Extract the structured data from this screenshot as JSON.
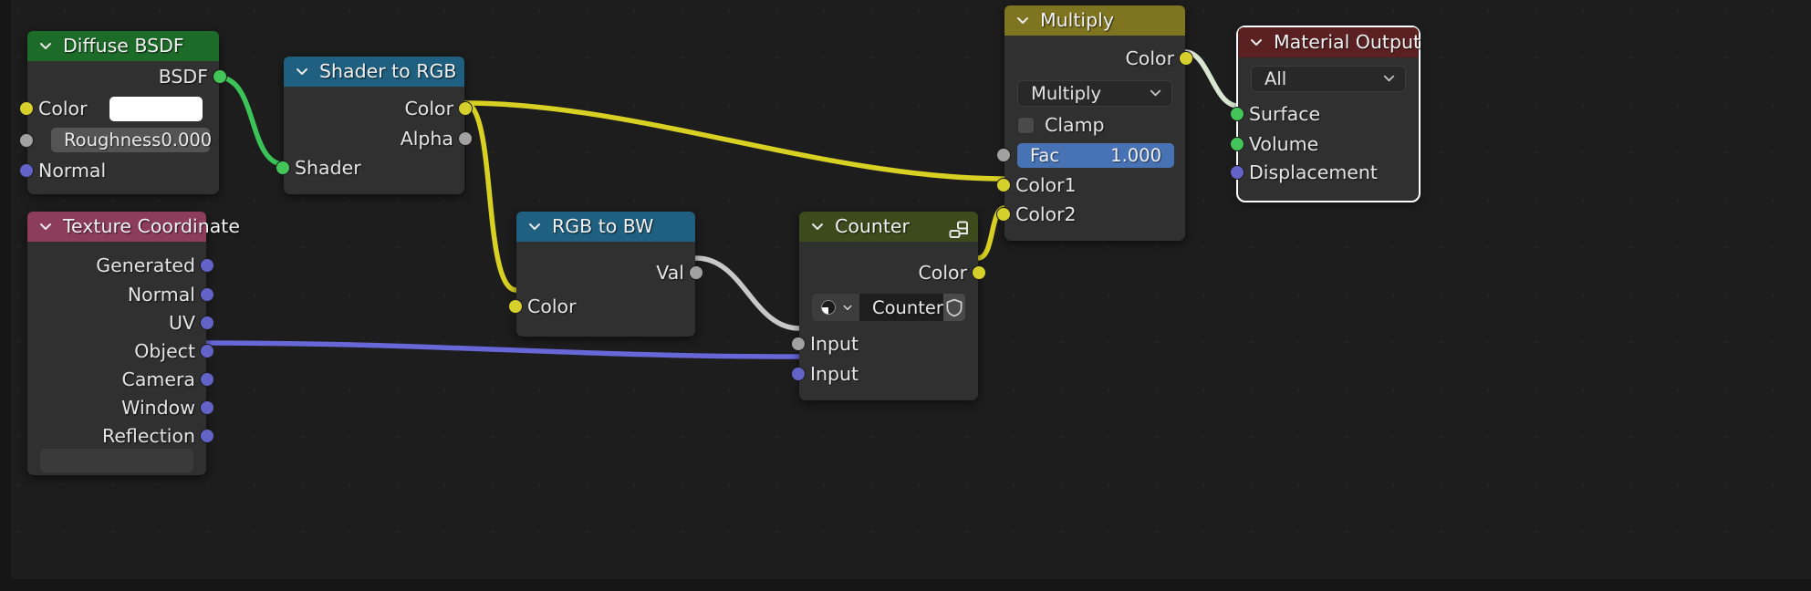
{
  "editor": {
    "name": "blender-shader-node-editor",
    "background": "#1d1d1d"
  },
  "colors": {
    "header_shader": "#1d6b29",
    "header_converter": "#1f6080",
    "header_input": "#8d3d5c",
    "header_color": "#7f7521",
    "header_group": "#3d4a1c",
    "header_output": "#5b2122",
    "socket_shader": "#44c55a",
    "socket_color": "#d6d02c",
    "socket_value": "#a1a1a1",
    "socket_vector": "#6363c7",
    "link_shader": "#3cc357",
    "link_color": "#d8d023",
    "link_value": "#c8c8c8",
    "link_vector": "#6767d8",
    "slider_fill": "#4772b3"
  },
  "nodes": {
    "diffuse_bsdf": {
      "title": "Diffuse BSDF",
      "outputs": [
        {
          "label": "BSDF",
          "type": "shader"
        }
      ],
      "inputs": [
        {
          "label": "Color",
          "type": "color"
        },
        {
          "label": "Roughness",
          "type": "value"
        },
        {
          "label": "Normal",
          "type": "vector"
        }
      ],
      "color_value": "#ffffff",
      "roughness_label": "Roughness",
      "roughness_value": "0.000"
    },
    "texture_coordinate": {
      "title": "Texture Coordinate",
      "outputs": [
        {
          "label": "Generated",
          "type": "vector"
        },
        {
          "label": "Normal",
          "type": "vector"
        },
        {
          "label": "UV",
          "type": "vector"
        },
        {
          "label": "Object",
          "type": "vector"
        },
        {
          "label": "Camera",
          "type": "vector"
        },
        {
          "label": "Window",
          "type": "vector"
        },
        {
          "label": "Reflection",
          "type": "vector"
        }
      ]
    },
    "shader_to_rgb": {
      "title": "Shader to RGB",
      "outputs": [
        {
          "label": "Color",
          "type": "color"
        },
        {
          "label": "Alpha",
          "type": "value"
        }
      ],
      "inputs": [
        {
          "label": "Shader",
          "type": "shader"
        }
      ]
    },
    "rgb_to_bw": {
      "title": "RGB to BW",
      "outputs": [
        {
          "label": "Val",
          "type": "value"
        }
      ],
      "inputs": [
        {
          "label": "Color",
          "type": "color"
        }
      ]
    },
    "counter": {
      "title": "Counter",
      "header_icon": "node-group-icon",
      "outputs": [
        {
          "label": "Color",
          "type": "color"
        }
      ],
      "id_selector": {
        "icon": "node-tree-icon",
        "chevron": "chevron-down-icon",
        "name": "Counter",
        "fake_user_icon": "shield-icon"
      },
      "inputs": [
        {
          "label": "Input",
          "type": "value"
        },
        {
          "label": "Input",
          "type": "vector"
        }
      ]
    },
    "multiply": {
      "title": "Multiply",
      "outputs": [
        {
          "label": "Color",
          "type": "color"
        }
      ],
      "blend_mode": "Multiply",
      "clamp_label": "Clamp",
      "clamp_checked": false,
      "fac_label": "Fac",
      "fac_value": "1.000",
      "inputs": [
        {
          "label": "Fac",
          "type": "value"
        },
        {
          "label": "Color1",
          "type": "color"
        },
        {
          "label": "Color2",
          "type": "color"
        }
      ]
    },
    "material_output": {
      "title": "Material Output",
      "selected": true,
      "target": "All",
      "inputs": [
        {
          "label": "Surface",
          "type": "shader"
        },
        {
          "label": "Volume",
          "type": "shader"
        },
        {
          "label": "Displacement",
          "type": "vector"
        }
      ]
    }
  }
}
